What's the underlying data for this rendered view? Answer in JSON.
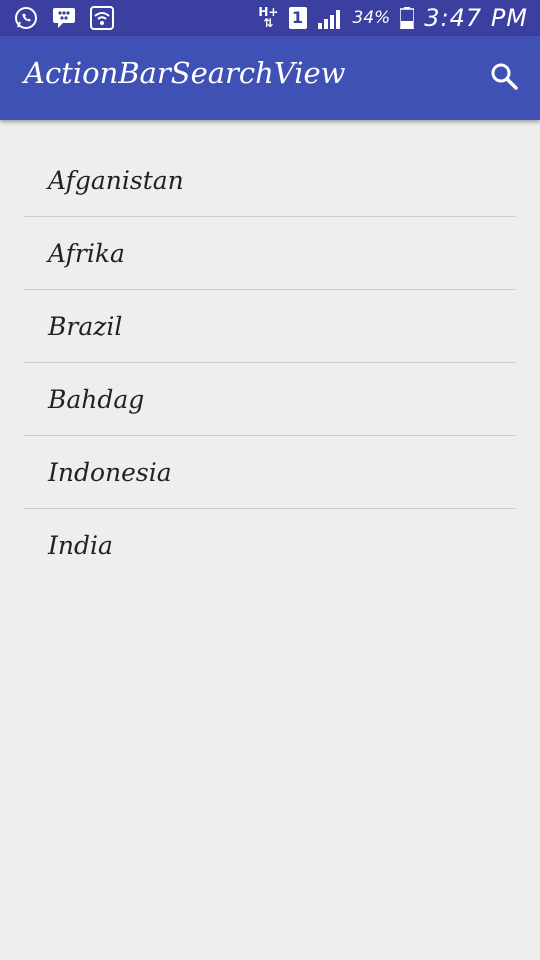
{
  "status_bar": {
    "network_type": "H+",
    "sim_slot": "1",
    "battery": "34%",
    "time": "3:47 PM"
  },
  "app_bar": {
    "title": "ActionBarSearchView",
    "search_icon": "search-icon"
  },
  "list": {
    "items": [
      {
        "label": "Afganistan"
      },
      {
        "label": "Afrika"
      },
      {
        "label": "Brazil"
      },
      {
        "label": "Bahdag"
      },
      {
        "label": "Indonesia"
      },
      {
        "label": "India"
      }
    ]
  },
  "colors": {
    "status_bar": "#3a3fa0",
    "app_bar": "#3f51b5",
    "background": "#eeeeee",
    "divider": "#cfcfcf"
  }
}
